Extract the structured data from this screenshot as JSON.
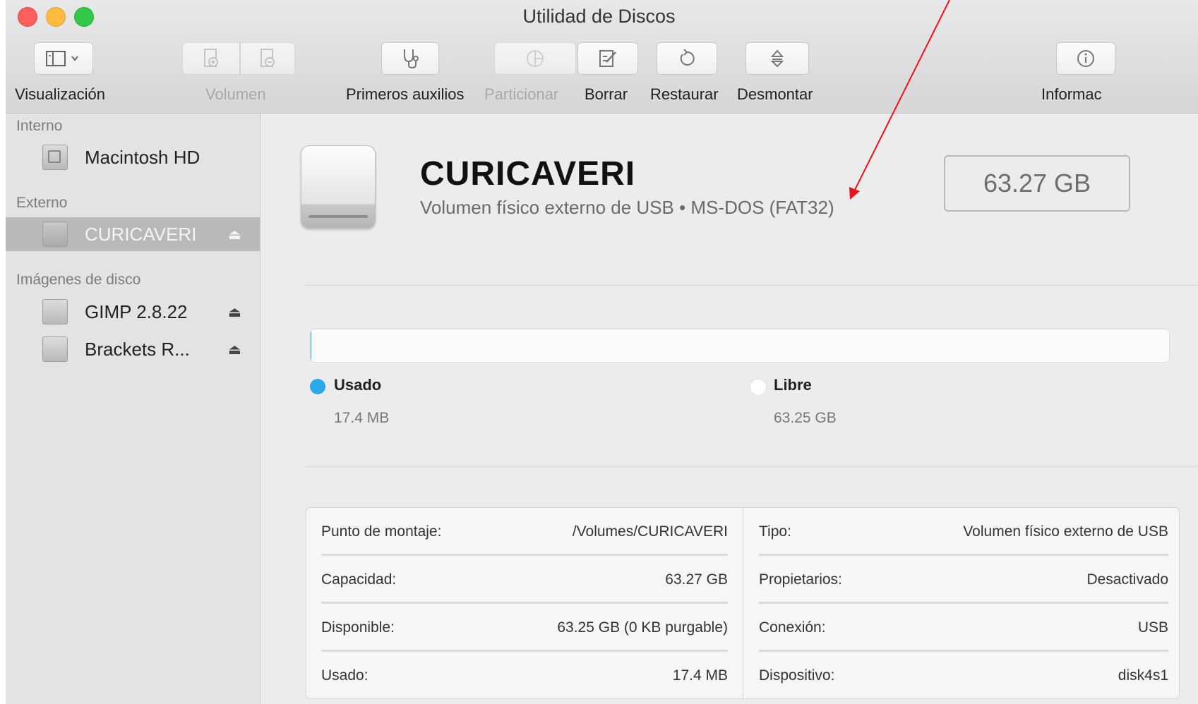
{
  "window": {
    "title": "Utilidad de Discos"
  },
  "toolbar": {
    "view_label": "Visualización",
    "volume_label": "Volumen",
    "first_aid_label": "Primeros auxilios",
    "partition_label": "Particionar",
    "erase_label": "Borrar",
    "restore_label": "Restaurar",
    "unmount_label": "Desmontar",
    "info_label": "Informac"
  },
  "sidebar": {
    "sections": {
      "internal": "Interno",
      "external": "Externo",
      "images": "Imágenes de disco"
    },
    "items": [
      {
        "label": "Macintosh HD",
        "section": "internal",
        "selected": false,
        "eject": false
      },
      {
        "label": "CURICAVERI",
        "section": "external",
        "selected": true,
        "eject": true
      },
      {
        "label": "GIMP 2.8.22",
        "section": "images",
        "selected": false,
        "eject": true
      },
      {
        "label": "Brackets R...",
        "section": "images",
        "selected": false,
        "eject": true
      }
    ],
    "eject_glyph": "⏏"
  },
  "volume": {
    "name": "CURICAVERI",
    "description": "Volumen físico externo de USB • MS-DOS (FAT32)",
    "capacity_badge": "63.27 GB"
  },
  "usage": {
    "used_fraction": 0.0003,
    "used_title": "Usado",
    "used_value": "17.4 MB",
    "free_title": "Libre",
    "free_value": "63.25 GB",
    "used_color": "#2aa8e8"
  },
  "info": {
    "left": [
      {
        "key": "Punto de montaje:",
        "value": "/Volumes/CURICAVERI"
      },
      {
        "key": "Capacidad:",
        "value": "63.27 GB"
      },
      {
        "key": "Disponible:",
        "value": "63.25 GB (0 KB purgable)"
      },
      {
        "key": "Usado:",
        "value": "17.4 MB"
      }
    ],
    "right": [
      {
        "key": "Tipo:",
        "value": "Volumen físico externo de USB"
      },
      {
        "key": "Propietarios:",
        "value": "Desactivado"
      },
      {
        "key": "Conexión:",
        "value": "USB"
      },
      {
        "key": "Dispositivo:",
        "value": "disk4s1"
      }
    ]
  },
  "annotation": {
    "arrow_color": "#e8121a"
  }
}
